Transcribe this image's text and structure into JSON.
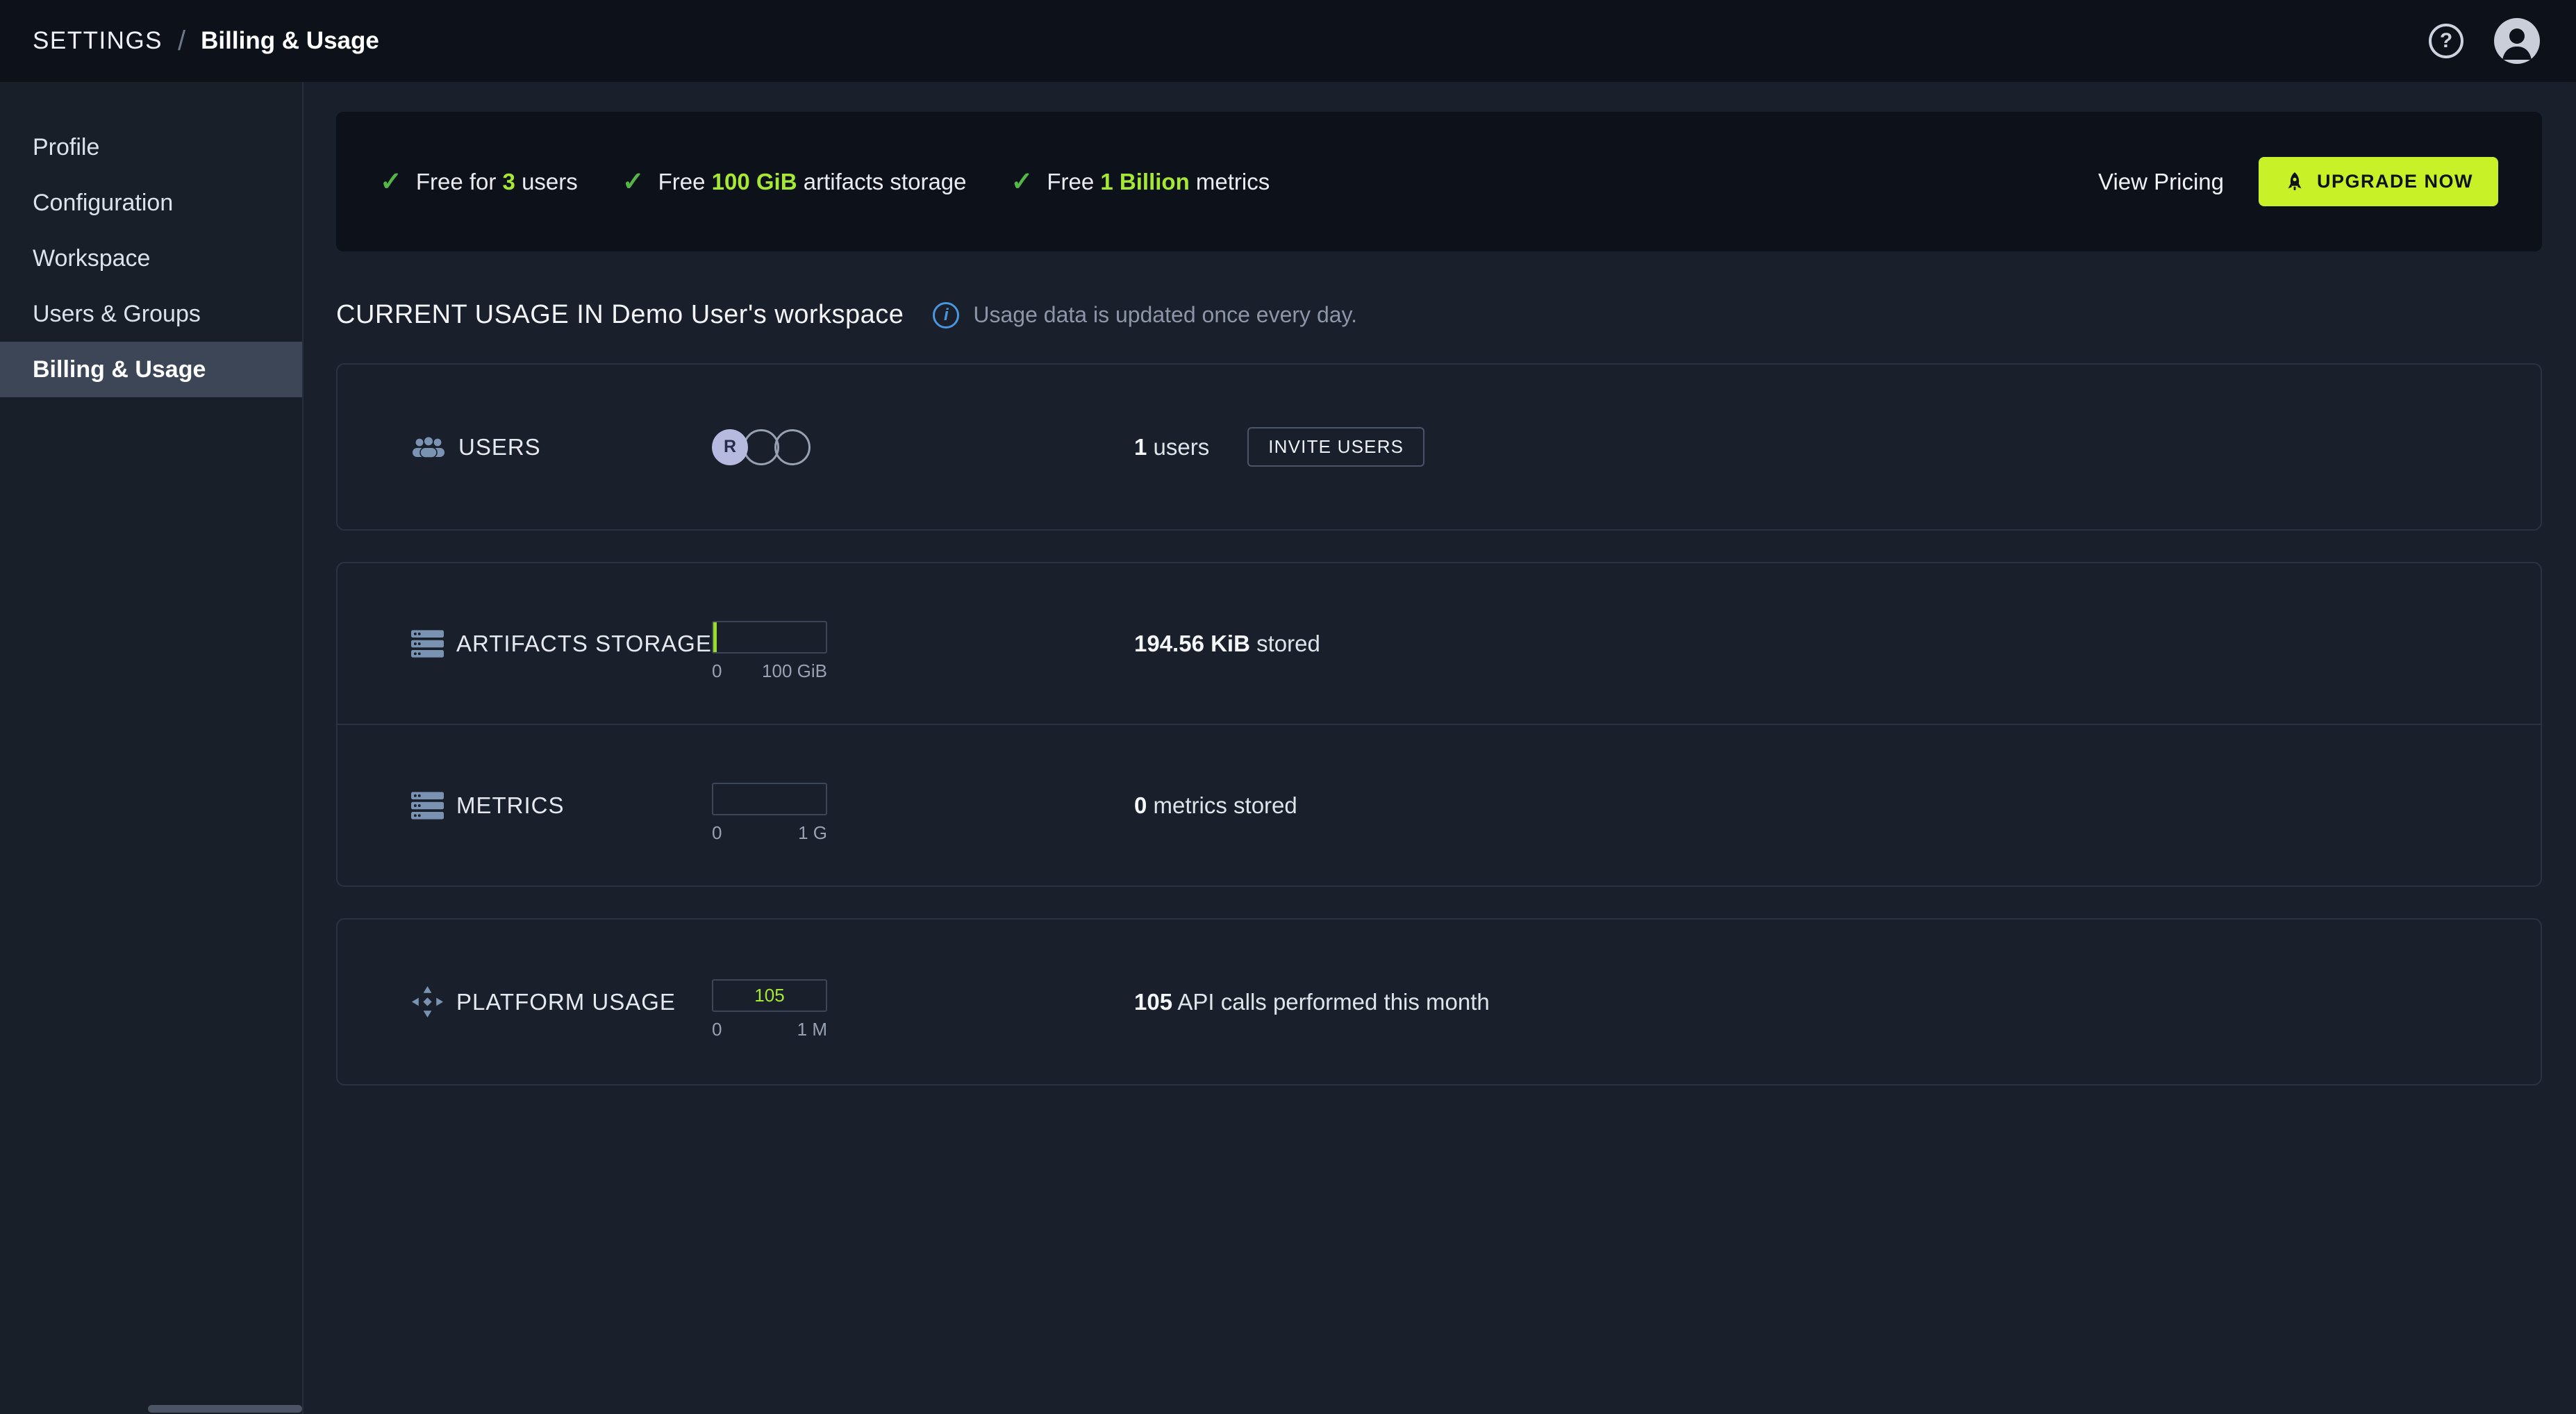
{
  "topbar": {
    "breadcrumb": {
      "root": "SETTINGS",
      "separator": "/",
      "current": "Billing & Usage"
    }
  },
  "icons": {
    "check": "✓",
    "help": "?",
    "info": "i"
  },
  "sidebar": {
    "items": [
      {
        "label": "Profile",
        "active": false
      },
      {
        "label": "Configuration",
        "active": false
      },
      {
        "label": "Workspace",
        "active": false
      },
      {
        "label": "Users & Groups",
        "active": false
      },
      {
        "label": "Billing & Usage",
        "active": true
      }
    ]
  },
  "banner": {
    "perks": [
      {
        "pre": "Free for ",
        "highlight": "3",
        "post": " users"
      },
      {
        "pre": "Free ",
        "highlight": "100 GiB",
        "post": " artifacts storage"
      },
      {
        "pre": "Free ",
        "highlight": "1 Billion",
        "post": " metrics"
      }
    ],
    "view_pricing_label": "View Pricing",
    "upgrade_label": "UPGRADE NOW"
  },
  "usage": {
    "title": "CURRENT USAGE IN Demo User's workspace",
    "note": "Usage data is updated once every day.",
    "users": {
      "title": "USERS",
      "avatar_initial": "R",
      "count": "1",
      "count_label": " users",
      "invite_label": "INVITE USERS"
    },
    "artifacts": {
      "title": "ARTIFACTS STORAGE",
      "bar_min": "0",
      "bar_max": "100 GiB",
      "value": "194.56 KiB",
      "label": " stored"
    },
    "metrics": {
      "title": "METRICS",
      "bar_min": "0",
      "bar_max": "1 G",
      "value": "0",
      "label": " metrics stored"
    },
    "platform": {
      "title": "PLATFORM USAGE",
      "bar_value": "105",
      "bar_min": "0",
      "bar_max": "1 M",
      "value": "105",
      "label": " API calls performed this month"
    }
  },
  "colors": {
    "topbar_bg": "#0d1119",
    "page_bg": "#1a202b",
    "accent_green": "#c9f128",
    "highlight_green": "#a6e834",
    "check_green": "#53b748",
    "icon_blue": "#7a93b2",
    "info_blue": "#4a97e0",
    "avatar_lavender": "#b6badf",
    "selected_item_bg": "#3d4657"
  }
}
